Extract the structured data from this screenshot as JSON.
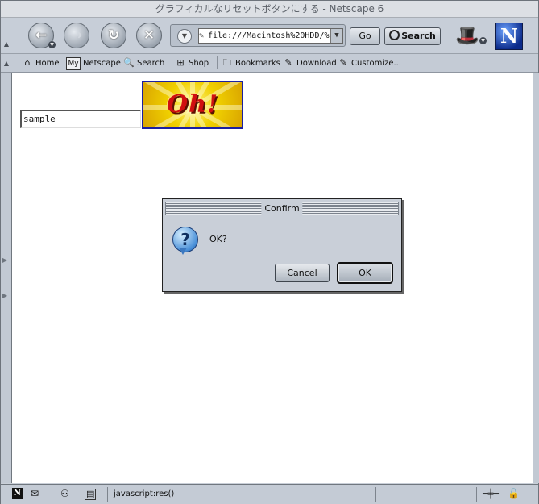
{
  "window": {
    "title": "グラフィカルなリセットボタンにする - Netscape 6"
  },
  "toolbar": {
    "back_icon": "back-arrow-icon",
    "forward_icon": "forward-arrow-icon",
    "reload_icon": "reload-icon",
    "stop_icon": "stop-x-icon",
    "url": "file:///Macintosh%20HDD/%9",
    "go_label": "Go",
    "search_label": "Search"
  },
  "personal_toolbar": {
    "items": [
      {
        "label": "Home",
        "icon": "home-icon"
      },
      {
        "label": "Netscape",
        "icon": "my-netscape-icon",
        "badge": "My"
      },
      {
        "label": "Search",
        "icon": "search-icon"
      },
      {
        "label": "Shop",
        "icon": "shop-icon"
      },
      {
        "label": "Bookmarks",
        "icon": "folder-icon"
      },
      {
        "label": "Download",
        "icon": "bookmark-icon"
      },
      {
        "label": "Customize...",
        "icon": "bookmark-icon"
      }
    ]
  },
  "content": {
    "input_value": "sample",
    "image_button_text": "Oh!"
  },
  "dialog": {
    "title": "Confirm",
    "message": "OK?",
    "cancel_label": "Cancel",
    "ok_label": "OK"
  },
  "status": {
    "text": "javascript:res()"
  },
  "colors": {
    "chrome": "#c9cfd8",
    "content_bg": "#ffffff",
    "image_border": "#1b1fa0",
    "image_text": "#d01010"
  }
}
